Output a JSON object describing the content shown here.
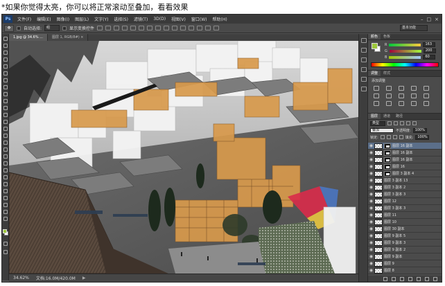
{
  "caption": "*如果你觉得太亮，你可以将正常滚动至叠加，看看效果",
  "app": {
    "logo": "Ps",
    "menu": [
      "文件(F)",
      "编辑(E)",
      "图像(I)",
      "图层(L)",
      "文字(Y)",
      "选择(S)",
      "滤镜(T)",
      "3D(D)",
      "视图(V)",
      "窗口(W)",
      "帮助(H)"
    ],
    "window_controls": [
      "–",
      "□",
      "×"
    ]
  },
  "options_bar": {
    "auto_select_label": "自动选择:",
    "auto_select_value": "组",
    "show_transform_label": "显示变换控件",
    "workspace": "基本功能"
  },
  "tabs": [
    {
      "label": "1.jpg @ 34.6% ...",
      "active": true
    },
    {
      "label": "图层 1, RGB/8#) ×",
      "active": false
    }
  ],
  "status": {
    "zoom": "34.62%",
    "doc": "文档:16.0M/420.0M"
  },
  "color_panel": {
    "tabs": [
      "颜色",
      "色板"
    ],
    "channels": [
      {
        "label": "R",
        "value": "163"
      },
      {
        "label": "G",
        "value": "200"
      },
      {
        "label": "B",
        "value": "60"
      }
    ],
    "fg_color": "#9dc83c"
  },
  "adjustments_panel": {
    "tabs": [
      "调整",
      "样式"
    ],
    "title": "添加调整"
  },
  "layers_panel": {
    "tabs": [
      "图层",
      "通道",
      "路径"
    ],
    "filter_label": "类型",
    "blend_mode": "叠加",
    "opacity_label": "不透明度:",
    "opacity_value": "100%",
    "lock_label": "锁定:",
    "fill_label": "填充:",
    "fill_value": "100%",
    "layers": [
      {
        "name": "图层 16 副本",
        "mask": true,
        "selected": true
      },
      {
        "name": "图层 16 副本",
        "mask": true,
        "selected": false
      },
      {
        "name": "图层 16 副本",
        "mask": true,
        "selected": false
      },
      {
        "name": "图层 16",
        "mask": true,
        "selected": false
      },
      {
        "name": "图层 3 副本 4",
        "mask": true,
        "selected": false
      },
      {
        "name": "图层 3 副本 13",
        "mask": false,
        "selected": false
      },
      {
        "name": "图层 3 副本 2",
        "mask": false,
        "selected": false
      },
      {
        "name": "图层 3 副本 3",
        "mask": false,
        "selected": false
      },
      {
        "name": "图层 12",
        "mask": false,
        "selected": false
      },
      {
        "name": "图层 3 副本 3",
        "mask": false,
        "selected": false
      },
      {
        "name": "图层 11",
        "mask": false,
        "selected": false
      },
      {
        "name": "图层 10",
        "mask": false,
        "selected": false
      },
      {
        "name": "图层 30 副本",
        "mask": false,
        "selected": false
      },
      {
        "name": "图层 9 副本 5",
        "mask": false,
        "selected": false
      },
      {
        "name": "图层 9 副本 3",
        "mask": false,
        "selected": false
      },
      {
        "name": "图层 9 副本 2",
        "mask": false,
        "selected": false
      },
      {
        "name": "图层 9 副本",
        "mask": false,
        "selected": false
      },
      {
        "name": "图层 9",
        "mask": false,
        "selected": false
      },
      {
        "name": "图层 8",
        "mask": false,
        "selected": false
      }
    ]
  }
}
